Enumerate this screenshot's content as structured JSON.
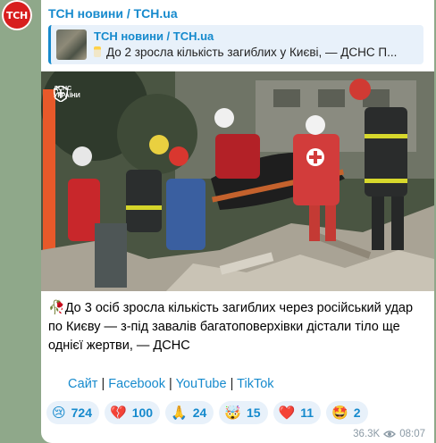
{
  "avatar": {
    "text": "ТСН"
  },
  "message": {
    "channel_name": "ТСН новини / TCH.ua",
    "reply": {
      "title": "ТСН новини / TCH.ua",
      "text": "До 2 зросла кількість загиблих у Києві, — ДСНС П..."
    },
    "photo": {
      "watermark_line1": "ДСНС",
      "watermark_line2": "УКРАЇНИ"
    },
    "caption_emoji": "🥀",
    "caption": "До 3 осіб зросла кількість загиблих через російський удар по Києву — з-під завалів багатоповерхівки дістали тіло ще однієї жертви, — ДСНС",
    "links": [
      {
        "label": "Сайт"
      },
      {
        "label": "Facebook"
      },
      {
        "label": "YouTube"
      },
      {
        "label": "TikTok"
      }
    ],
    "link_separator": "|",
    "reactions": [
      {
        "emoji": "😢",
        "count": "724",
        "icon": "crying-face-icon"
      },
      {
        "emoji": "💔",
        "count": "100",
        "icon": "broken-heart-icon"
      },
      {
        "emoji": "🙏",
        "count": "24",
        "icon": "praying-hands-icon"
      },
      {
        "emoji": "🤯",
        "count": "15",
        "icon": "exploding-head-icon"
      },
      {
        "emoji": "❤️",
        "count": "11",
        "icon": "heart-icon"
      },
      {
        "emoji": "🤩",
        "count": "2",
        "icon": "star-struck-icon"
      }
    ],
    "views": "36.3K",
    "time": "08:07"
  },
  "colors": {
    "accent": "#168acd",
    "avatar_bg": "#d81e1e",
    "chat_bg": "#8fa88a",
    "reaction_bg": "#e8f1fa"
  }
}
